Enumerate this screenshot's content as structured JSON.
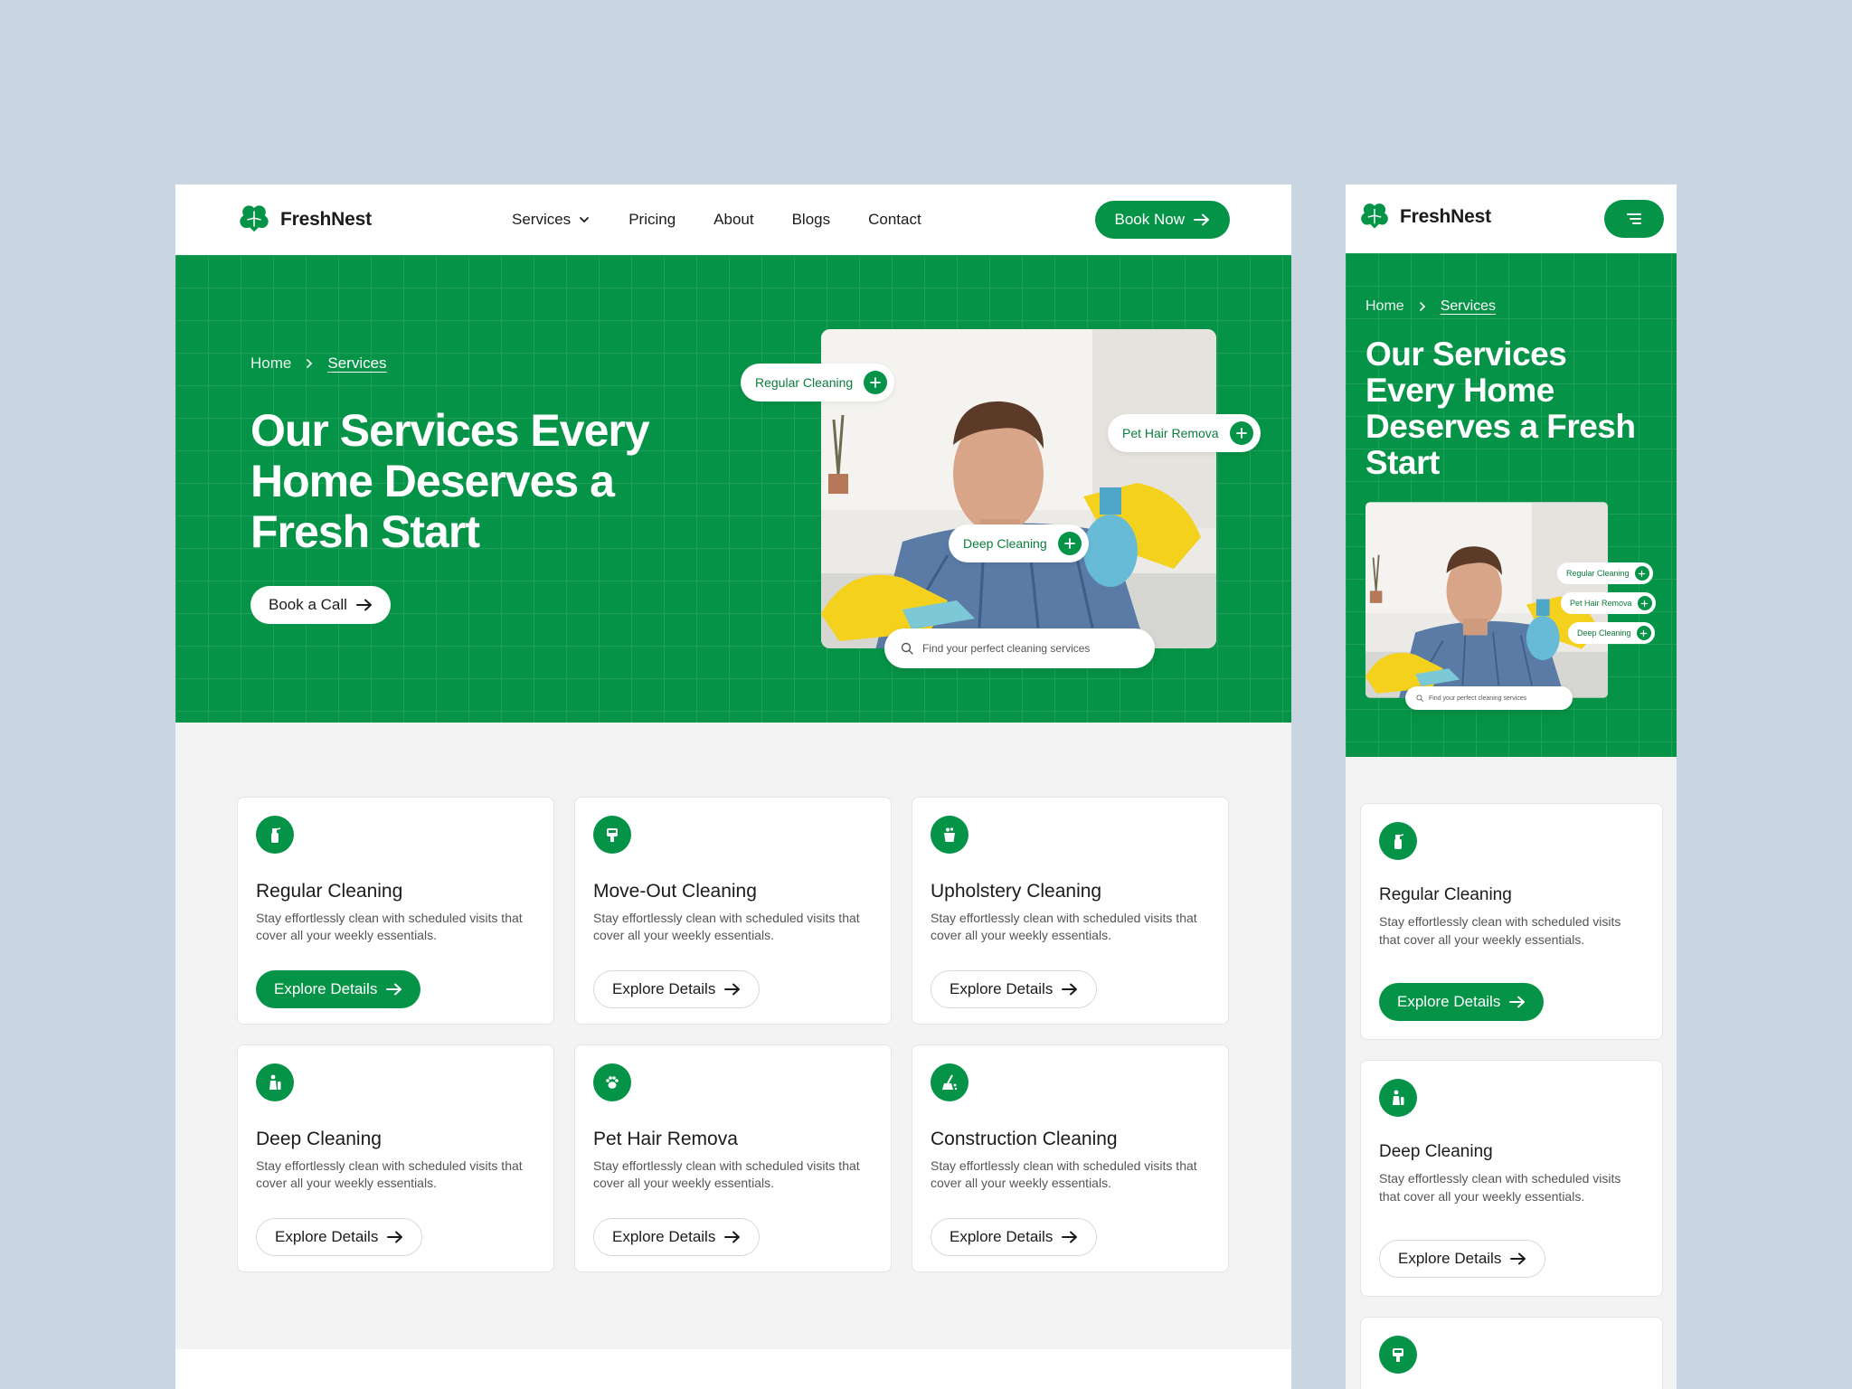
{
  "brand": {
    "name": "FreshNest",
    "accent": "#059447"
  },
  "nav": {
    "items": [
      {
        "label": "Services",
        "has_dropdown": true
      },
      {
        "label": "Pricing"
      },
      {
        "label": "About"
      },
      {
        "label": "Blogs"
      },
      {
        "label": "Contact"
      }
    ],
    "cta": "Book Now"
  },
  "hero": {
    "breadcrumb": {
      "home": "Home",
      "current": "Services"
    },
    "title": "Our Services Every Home Deserves a Fresh Start",
    "cta": "Book a Call",
    "tags": [
      "Regular Cleaning",
      "Pet Hair Remova",
      "Deep Cleaning"
    ],
    "search_placeholder": "Find your perfect cleaning services"
  },
  "services": [
    {
      "title": "Regular Cleaning",
      "desc": "Stay effortlessly clean with scheduled visits that cover all your weekly essentials.",
      "cta": "Explore Details",
      "icon": "spray-bottle-icon",
      "highlighted": true
    },
    {
      "title": "Move-Out Cleaning",
      "desc": "Stay effortlessly clean with scheduled visits that cover all your weekly essentials.",
      "cta": "Explore Details",
      "icon": "cleaning-machine-icon",
      "highlighted": false
    },
    {
      "title": "Upholstery Cleaning",
      "desc": "Stay effortlessly clean with scheduled visits that cover all your weekly essentials.",
      "cta": "Explore Details",
      "icon": "bucket-icon",
      "highlighted": false
    },
    {
      "title": "Deep Cleaning",
      "desc": "Stay effortlessly clean with scheduled visits that cover all your weekly essentials.",
      "cta": "Explore Details",
      "icon": "cleaner-person-icon",
      "highlighted": false
    },
    {
      "title": "Pet Hair Remova",
      "desc": "Stay effortlessly clean with scheduled visits that cover all your weekly essentials.",
      "cta": "Explore Details",
      "icon": "paw-icon",
      "highlighted": false
    },
    {
      "title": "Construction Cleaning",
      "desc": "Stay effortlessly clean with scheduled visits that cover all your weekly essentials.",
      "cta": "Explore Details",
      "icon": "broom-icon",
      "highlighted": false
    }
  ]
}
